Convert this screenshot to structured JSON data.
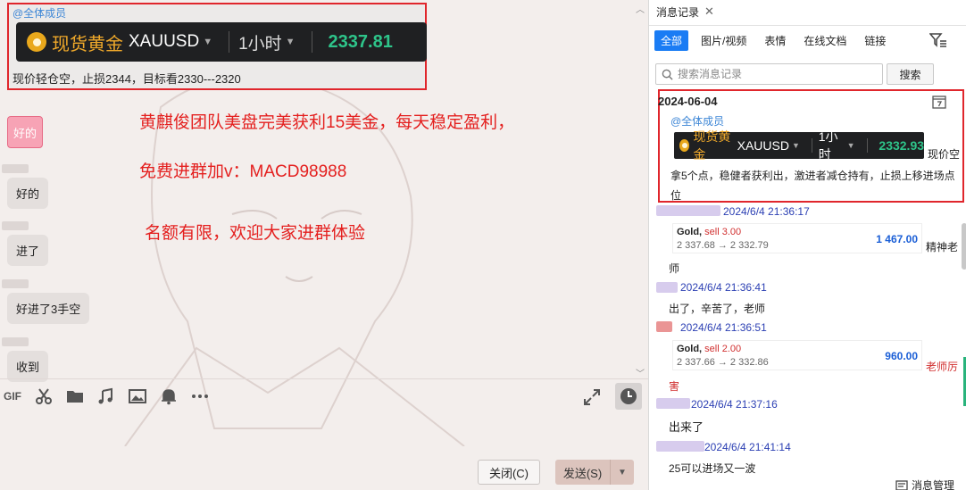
{
  "chat": {
    "pinned": {
      "mention": "@全体成员",
      "ticker": {
        "name": "现货黄金",
        "symbol": "XAUUSD",
        "timeframe": "1小时",
        "price": "2337.81"
      },
      "note": "现价轻仓空，止损2344，目标看2330---2320"
    },
    "promo": [
      "黄麒俊团队美盘完美获利15美金，每天稳定盈利，",
      "免费进群加v：MACD98988",
      "名额有限，欢迎大家进群体验"
    ],
    "sticker_text": "好的",
    "messages": [
      "好的",
      "进了",
      "好进了3手空",
      "收到"
    ],
    "toolbar": {
      "gif_label": "GIF"
    },
    "close_label": "关闭(C)",
    "send_label": "发送(S)"
  },
  "panel": {
    "tab_label": "消息记录",
    "filters": [
      "全部",
      "图片/视频",
      "表情",
      "在线文档",
      "链接"
    ],
    "search_placeholder": "搜索消息记录",
    "search_button": "搜索",
    "highlight": {
      "date": "2024-06-04",
      "mention": "@全体成员",
      "ticker": {
        "name": "现货黄金",
        "symbol": "XAUUSD",
        "timeframe": "1小时",
        "price": "2332.93"
      },
      "trail": "现价空",
      "body": "拿5个点，稳健者获利出，激进者减仓持有，止损上移进场点位"
    },
    "records": [
      {
        "time": "2024/6/4 21:36:17"
      },
      {
        "trade_title": "Gold,",
        "trade_side": "sell 3.00",
        "trade_prices": "2 337.68 → 2 332.79",
        "pnl": "1 467.00",
        "tail": "精神老",
        "wrap": "师"
      },
      {
        "time": "2024/6/4 21:36:41",
        "text": "出了，辛苦了，老师"
      },
      {
        "time": "2024/6/4 21:36:51"
      },
      {
        "trade_title": "Gold,",
        "trade_side": "sell 2.00",
        "trade_prices": "2 337.66 → 2 332.86",
        "pnl": "960.00",
        "tail": "老师厉",
        "wrap": "害"
      },
      {
        "time": "2024/6/4 21:37:16",
        "text": "出来了"
      },
      {
        "time": "2024/6/4 21:41:14",
        "text": "25可以进场又一波"
      }
    ],
    "manage_label": "消息管理",
    "colors": {
      "accent": "#1a7cf4",
      "highlight_border": "#e0262c",
      "promo_text": "#e4201f",
      "gain": "#2ec48a"
    }
  }
}
